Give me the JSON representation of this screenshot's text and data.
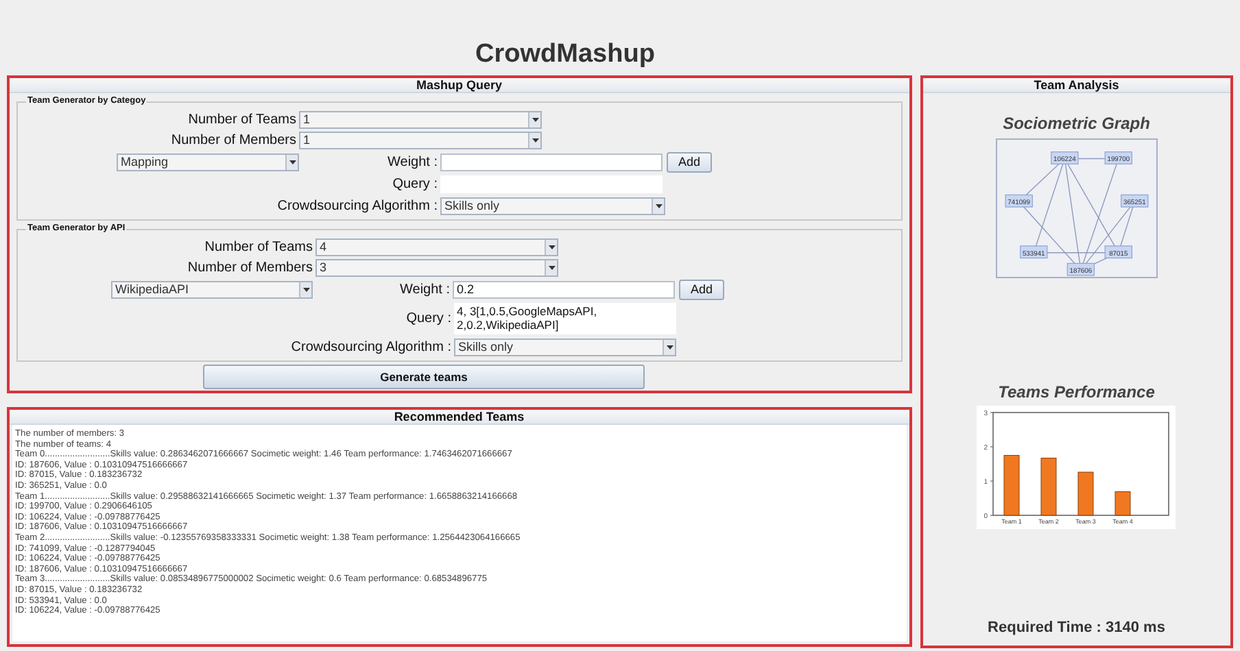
{
  "app_title": "CrowdMashup",
  "mashup_query": {
    "title": "Mashup Query",
    "sections": [
      {
        "legend": "Team Generator by Categoy",
        "teams_label": "Number of Teams",
        "teams_value": "1",
        "members_label": "Number of Members",
        "members_value": "1",
        "source_value": "Mapping",
        "weight_label": "Weight :",
        "add_button": "Add",
        "query_label": "Query :",
        "algorithm_label": "Crowdsourcing Algorithm :",
        "algorithm_value": "Skills only"
      },
      {
        "legend": "Team Generator by API",
        "teams_label": "Number of Teams",
        "teams_value": "4",
        "members_label": "Number of Members",
        "members_value": "3",
        "source_value": "WikipediaAPI",
        "weight_label": "Weight :",
        "weight_value": "0.2",
        "add_button": "Add",
        "query_label": "Query :",
        "query_value": "4, 3[1,0.5,GoogleMapsAPI,\n2,0.2,WikipediaAPI]",
        "algorithm_label": "Crowdsourcing Algorithm :",
        "algorithm_value": "Skills only"
      }
    ],
    "generate_button": "Generate teams"
  },
  "recommended_teams": {
    "title": "Recommended Teams",
    "lines": [
      "The number of members: 3",
      "The number of teams: 4",
      "Team 0..........................Skills value: 0.2863462071666667 Socimetic weight: 1.46 Team performance: 1.7463462071666667",
      "ID: 187606, Value : 0.10310947516666667",
      "ID: 87015, Value : 0.183236732",
      "ID: 365251, Value : 0.0",
      "Team 1..........................Skills value: 0.29588632141666665 Socimetic weight: 1.37 Team performance: 1.6658863214166668",
      "ID: 199700, Value : 0.2906646105",
      "ID: 106224, Value : -0.09788776425",
      "ID: 187606, Value : 0.10310947516666667",
      "Team 2..........................Skills value: -0.12355769358333331 Socimetic weight: 1.38 Team performance: 1.2564423064166665",
      "ID: 741099, Value : -0.1287794045",
      "ID: 106224, Value : -0.09788776425",
      "ID: 187606, Value : 0.10310947516666667",
      "Team 3..........................Skills value: 0.08534896775000002 Socimetic weight: 0.6 Team performance: 0.68534896775",
      "ID: 87015, Value : 0.183236732",
      "ID: 533941, Value : 0.0",
      "ID: 106224, Value : -0.09788776425"
    ]
  },
  "team_analysis": {
    "title": "Team Analysis",
    "graph_title": "Sociometric Graph",
    "graph_nodes": [
      "106224",
      "199700",
      "741099",
      "365251",
      "533941",
      "87015",
      "187606"
    ],
    "chart_title": "Teams Performance",
    "chart_data": {
      "type": "bar",
      "categories": [
        "Team 1",
        "Team 2",
        "Team 3",
        "Team 4"
      ],
      "series": [
        {
          "color": "#f07820",
          "values": [
            1.75,
            1.67,
            1.26,
            0.69
          ]
        }
      ],
      "ylim": [
        0,
        3
      ],
      "yticks": [
        0,
        1,
        2,
        3
      ]
    },
    "required_time": "Required Time : 3140 ms"
  }
}
